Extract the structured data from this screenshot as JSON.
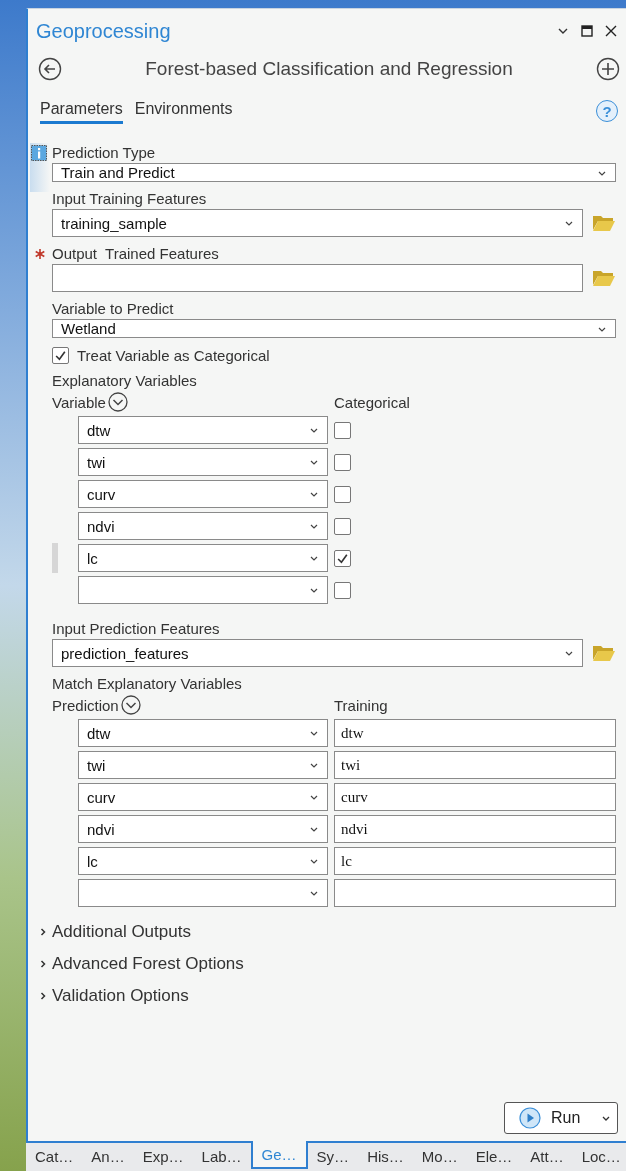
{
  "window": {
    "title": "Geoprocessing"
  },
  "tool": {
    "title": "Forest-based Classification and Regression"
  },
  "tabs": [
    {
      "label": "Parameters",
      "selected": true
    },
    {
      "label": "Environments",
      "selected": false
    }
  ],
  "help_button": {
    "label": "?"
  },
  "prediction_type": {
    "label": "Prediction Type",
    "value": "Train and Predict"
  },
  "input_training_features": {
    "label": "Input Training Features",
    "value": "training_sample"
  },
  "output_trained_features": {
    "label": "Output  Trained Features",
    "required": true
  },
  "variable_to_predict": {
    "label": "Variable to Predict",
    "value": "Wetland"
  },
  "treat_as_categorical": {
    "label": "Treat Variable as Categorical",
    "checked": true
  },
  "explanatory_variables": {
    "label": "Explanatory Variables",
    "column_1": "Variable",
    "column_2": "Categorical",
    "rows": [
      {
        "variable": "dtw",
        "categorical": false,
        "selected": false
      },
      {
        "variable": "twi",
        "categorical": false,
        "selected": false
      },
      {
        "variable": "curv",
        "categorical": false,
        "selected": false
      },
      {
        "variable": "ndvi",
        "categorical": false,
        "selected": false
      },
      {
        "variable": "lc",
        "categorical": true,
        "selected": true
      },
      {
        "categorical": false,
        "selected": false
      }
    ]
  },
  "input_prediction_features": {
    "label": "Input Prediction Features",
    "value": "prediction_features"
  },
  "match_explanatory_variables": {
    "label": "Match Explanatory Variables",
    "column_1": "Prediction",
    "column_2": "Training",
    "rows": [
      {
        "prediction": "dtw",
        "training": "dtw"
      },
      {
        "prediction": "twi",
        "training": "twi"
      },
      {
        "prediction": "curv",
        "training": "curv"
      },
      {
        "prediction": "ndvi",
        "training": "ndvi"
      },
      {
        "prediction": "lc",
        "training": "lc"
      },
      {}
    ]
  },
  "sections": [
    {
      "label": "Additional Outputs",
      "expanded": false
    },
    {
      "label": "Advanced Forest Options",
      "expanded": false
    },
    {
      "label": "Validation Options",
      "expanded": false
    }
  ],
  "run_button": {
    "label": "Run"
  },
  "bottom_tabs": [
    {
      "label": "Cat…",
      "selected": false
    },
    {
      "label": "An…",
      "selected": false
    },
    {
      "label": "Exp…",
      "selected": false
    },
    {
      "label": "Lab…",
      "selected": false
    },
    {
      "label": "Ge…",
      "selected": true
    },
    {
      "label": "Sy…",
      "selected": false
    },
    {
      "label": "His…",
      "selected": false
    },
    {
      "label": "Mo…",
      "selected": false
    },
    {
      "label": "Ele…",
      "selected": false
    },
    {
      "label": "Att…",
      "selected": false
    },
    {
      "label": "Loc…",
      "selected": false
    }
  ]
}
